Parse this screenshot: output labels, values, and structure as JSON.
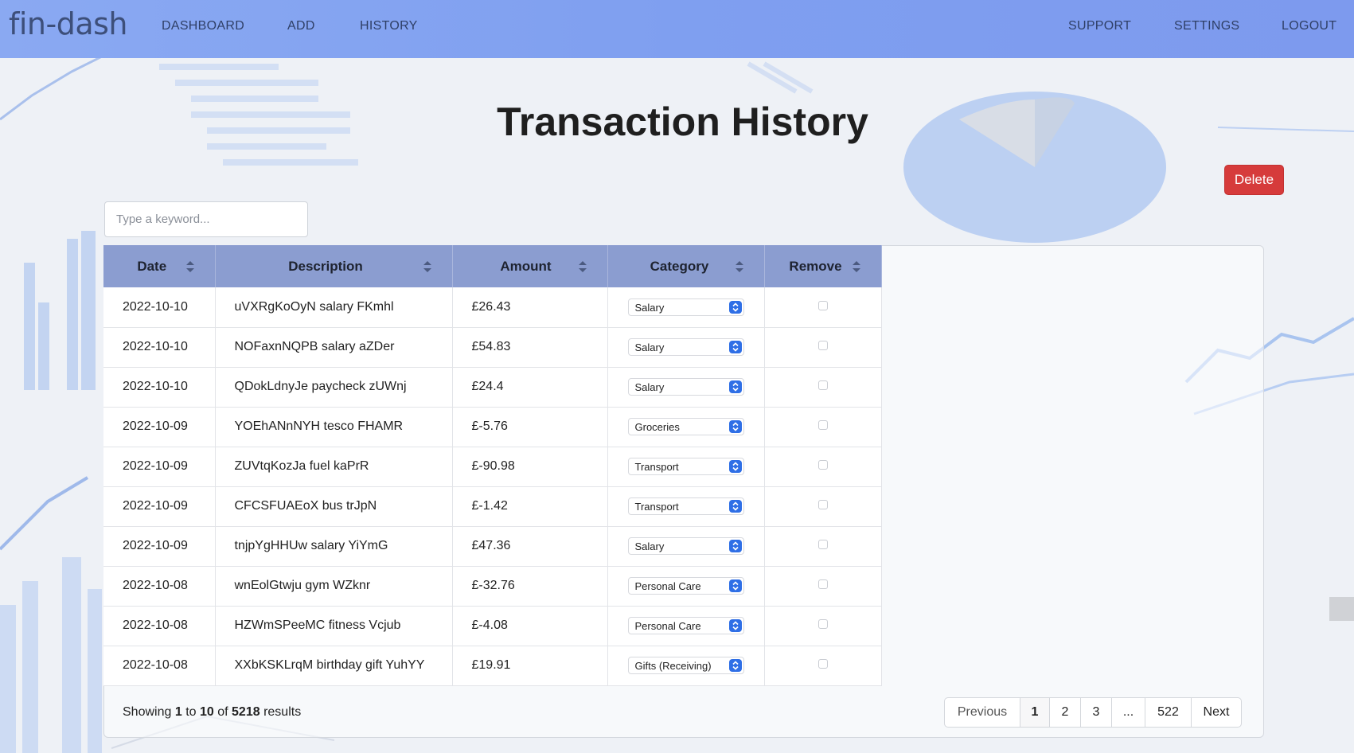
{
  "nav": {
    "brand": "fin-dash",
    "links": [
      "DASHBOARD",
      "ADD",
      "HISTORY"
    ],
    "right_links": [
      "SUPPORT",
      "SETTINGS",
      "LOGOUT"
    ]
  },
  "page": {
    "title": "Transaction History",
    "delete_label": "Delete",
    "search_placeholder": "Type a keyword..."
  },
  "table": {
    "headers": [
      "Date",
      "Description",
      "Amount",
      "Category",
      "Remove"
    ],
    "rows": [
      {
        "date": "2022-10-10",
        "description": "uVXRgKoOyN salary FKmhl",
        "amount": "£26.43",
        "category": "Salary"
      },
      {
        "date": "2022-10-10",
        "description": "NOFaxnNQPB salary aZDer",
        "amount": "£54.83",
        "category": "Salary"
      },
      {
        "date": "2022-10-10",
        "description": "QDokLdnyJe paycheck zUWnj",
        "amount": "£24.4",
        "category": "Salary"
      },
      {
        "date": "2022-10-09",
        "description": "YOEhANnNYH tesco FHAMR",
        "amount": "£-5.76",
        "category": "Groceries"
      },
      {
        "date": "2022-10-09",
        "description": "ZUVtqKozJa fuel kaPrR",
        "amount": "£-90.98",
        "category": "Transport"
      },
      {
        "date": "2022-10-09",
        "description": "CFCSFUAEoX bus trJpN",
        "amount": "£-1.42",
        "category": "Transport"
      },
      {
        "date": "2022-10-09",
        "description": "tnjpYgHHUw salary YiYmG",
        "amount": "£47.36",
        "category": "Salary"
      },
      {
        "date": "2022-10-08",
        "description": "wnEolGtwju gym WZknr",
        "amount": "£-32.76",
        "category": "Personal Care"
      },
      {
        "date": "2022-10-08",
        "description": "HZWmSPeeMC fitness Vcjub",
        "amount": "£-4.08",
        "category": "Personal Care"
      },
      {
        "date": "2022-10-08",
        "description": "XXbKSKLrqM birthday gift YuhYY",
        "amount": "£19.91",
        "category": "Gifts (Receiving)"
      }
    ]
  },
  "summary": {
    "prefix": "Showing",
    "from": "1",
    "to_word": "to",
    "to": "10",
    "of_word": "of",
    "total": "5218",
    "suffix": "results"
  },
  "pagination": {
    "previous": "Previous",
    "pages": [
      "1",
      "2",
      "3",
      "...",
      "522"
    ],
    "next": "Next",
    "active": "1"
  },
  "colors": {
    "navbar": "#7f9ff0",
    "header": "#8b9dd0",
    "delete": "#d63b3b",
    "select_arrow": "#2f6fe6"
  }
}
